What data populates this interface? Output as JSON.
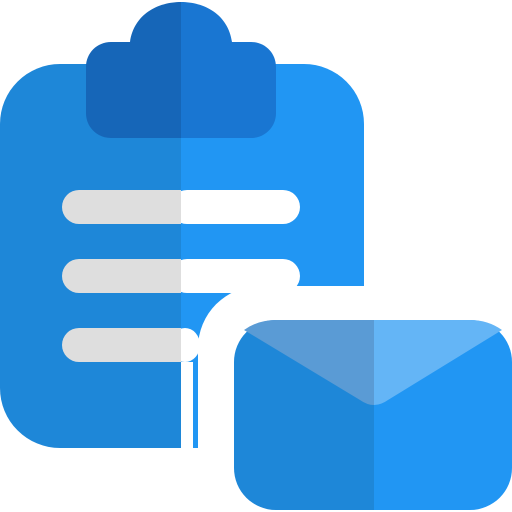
{
  "icon": {
    "name": "clipboard-mail-icon",
    "parts": [
      "clipboard",
      "clipboard-clip",
      "text-lines",
      "envelope"
    ]
  },
  "colors": {
    "clipboard_left": "#1E87D8",
    "clipboard_right": "#2196F3",
    "clip_left": "#1666B8",
    "clip_right": "#1976D2",
    "lines_left": "#DEDEDE",
    "lines_right": "#FFFFFF",
    "envelope_left": "#1E87D8",
    "envelope_right": "#2196F3",
    "flap_left": "#5A9BD5",
    "flap_right": "#64B5F6",
    "background": "#FFFFFF"
  }
}
